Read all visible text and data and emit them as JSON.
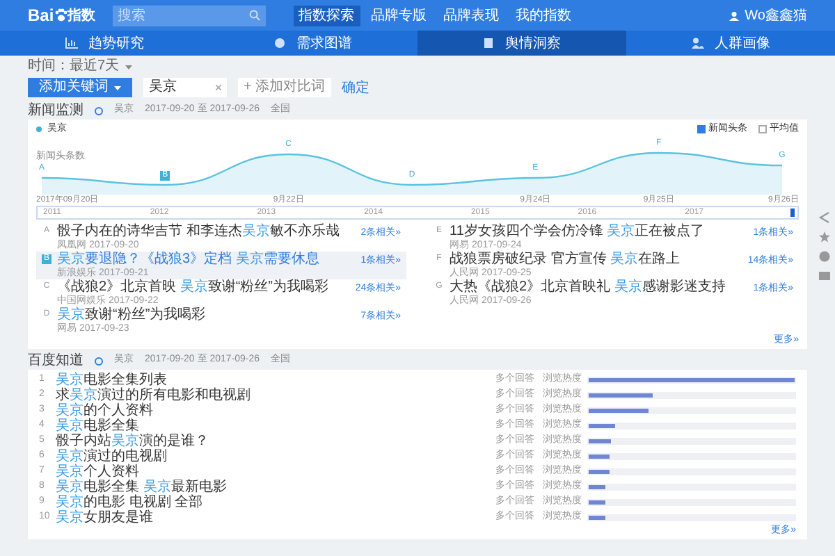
{
  "logo": {
    "text": "Bai",
    "suffix": "指数"
  },
  "search": {
    "placeholder": "搜索"
  },
  "nav": [
    {
      "label": "指数探索",
      "selected": true
    },
    {
      "label": "品牌专版",
      "selected": false
    },
    {
      "label": "品牌表现",
      "selected": false
    },
    {
      "label": "我的指数",
      "selected": false
    }
  ],
  "user": "Wo鑫鑫猫",
  "subnav": [
    {
      "label": "趋势研究",
      "selected": false
    },
    {
      "label": "需求图谱",
      "selected": false
    },
    {
      "label": "舆情洞察",
      "selected": true
    },
    {
      "label": "人群画像",
      "selected": false
    }
  ],
  "time_filter": "时间：最近7天",
  "keyword_bar": {
    "button": "添加关键词",
    "keyword": "吴京",
    "add": "+ 添加对比词",
    "confirm": "确定"
  },
  "news": {
    "title": "新闻监测",
    "meta": [
      "吴京",
      "2017-09-20 至 2017-09-26",
      "全国"
    ],
    "legend": "吴京",
    "y_label": "新闻头条数",
    "checkboxes": [
      {
        "label": "新闻头条",
        "checked": true
      },
      {
        "label": "平均值",
        "checked": false
      }
    ],
    "markers": [
      {
        "letter": "A",
        "selected": false
      },
      {
        "letter": "B",
        "selected": true
      },
      {
        "letter": "C",
        "selected": false
      },
      {
        "letter": "D",
        "selected": false
      },
      {
        "letter": "E",
        "selected": false
      },
      {
        "letter": "F",
        "selected": false
      },
      {
        "letter": "G",
        "selected": false
      }
    ],
    "x_labels": [
      "2017年09月20日",
      "9月22日",
      "9月24日",
      "9月25日",
      "9月26日"
    ],
    "timeline": {
      "years": [
        "2011",
        "2012",
        "2013",
        "2014",
        "2015",
        "2016",
        "2017"
      ],
      "level": 1
    },
    "items": [
      {
        "letter": "A",
        "selected": false,
        "parts": [
          {
            "text": "骰子内在的诗华吉节 和李连杰",
            "hl": false
          },
          {
            "text": "吴京",
            "hl": true
          },
          {
            "text": "敏不亦乐哉",
            "hl": false
          }
        ],
        "source": "凤凰网 2017-09-20",
        "related": "2条相关»"
      },
      {
        "letter": "B",
        "selected": true,
        "parts": [
          {
            "text": "吴京",
            "hl": true
          },
          {
            "text": "要退隐？《战狼3》定档 ",
            "hl": false
          },
          {
            "text": "吴京",
            "hl": true
          },
          {
            "text": "需要休息",
            "hl": false
          }
        ],
        "source": "新浪娱乐 2017-09-21",
        "related": "1条相关»"
      },
      {
        "letter": "C",
        "selected": false,
        "parts": [
          {
            "text": "《战狼2》北京首映 ",
            "hl": false
          },
          {
            "text": "吴京",
            "hl": true
          },
          {
            "text": "致谢“粉丝”为我喝彩",
            "hl": false
          }
        ],
        "source": "中国网娱乐 2017-09-22",
        "related": "24条相关»"
      },
      {
        "letter": "D",
        "selected": false,
        "parts": [
          {
            "text": "吴京",
            "hl": true
          },
          {
            "text": "致谢“粉丝”为我喝彩",
            "hl": false
          }
        ],
        "source": "网易 2017-09-23",
        "related": "7条相关»"
      },
      {
        "letter": "E",
        "selected": false,
        "parts": [
          {
            "text": "11岁女孩四个学会仿冷锋 ",
            "hl": false
          },
          {
            "text": "吴京",
            "hl": true
          },
          {
            "text": "正在被点了",
            "hl": false
          }
        ],
        "source": "网易 2017-09-24",
        "related": "1条相关»"
      },
      {
        "letter": "F",
        "selected": false,
        "parts": [
          {
            "text": "战狼票房破纪录 官方宣传 ",
            "hl": false
          },
          {
            "text": "吴京",
            "hl": true
          },
          {
            "text": "在路上",
            "hl": false
          }
        ],
        "source": "人民网 2017-09-25",
        "related": "14条相关»"
      },
      {
        "letter": "G",
        "selected": false,
        "parts": [
          {
            "text": "大热《战狼2》北京首映礼 ",
            "hl": false
          },
          {
            "text": "吴京",
            "hl": true
          },
          {
            "text": "感谢影迷支持",
            "hl": false
          }
        ],
        "source": "人民网 2017-09-26",
        "related": "1条相关»"
      }
    ],
    "more": "更多»"
  },
  "zhidao": {
    "title": "百度知道",
    "meta": [
      "吴京",
      "2017-09-20 至 2017-09-26",
      "全国"
    ],
    "items": [
      {
        "rank": "1",
        "parts": [
          {
            "text": "吴京",
            "hl": true
          },
          {
            "text": "电影全集列表",
            "hl": false
          }
        ],
        "answers": "多个回答",
        "heat_label": "浏览热度",
        "level": 1
      },
      {
        "rank": "2",
        "parts": [
          {
            "text": "求",
            "hl": false
          },
          {
            "text": "吴京",
            "hl": true
          },
          {
            "text": "演过的所有电影和电视剧",
            "hl": false
          }
        ],
        "answers": "多个回答",
        "heat_label": "浏览热度",
        "level": 0.31
      },
      {
        "rank": "3",
        "parts": [
          {
            "text": "吴京",
            "hl": true
          },
          {
            "text": "的个人资料",
            "hl": false
          }
        ],
        "answers": "多个回答",
        "heat_label": "浏览热度",
        "level": 0.29
      },
      {
        "rank": "4",
        "parts": [
          {
            "text": "吴京",
            "hl": true
          },
          {
            "text": "电影全集",
            "hl": false
          }
        ],
        "answers": "多个回答",
        "heat_label": "浏览热度",
        "level": 0.13
      },
      {
        "rank": "5",
        "parts": [
          {
            "text": "骰子内站",
            "hl": false
          },
          {
            "text": "吴京",
            "hl": true
          },
          {
            "text": "演的是谁？",
            "hl": false
          }
        ],
        "answers": "多个回答",
        "heat_label": "浏览热度",
        "level": 0.11
      },
      {
        "rank": "6",
        "parts": [
          {
            "text": "吴京",
            "hl": true
          },
          {
            "text": "演过的电视剧",
            "hl": false
          }
        ],
        "answers": "多个回答",
        "heat_label": "浏览热度",
        "level": 0.1
      },
      {
        "rank": "7",
        "parts": [
          {
            "text": "吴京",
            "hl": true
          },
          {
            "text": "个人资料",
            "hl": false
          }
        ],
        "answers": "多个回答",
        "heat_label": "浏览热度",
        "level": 0.1
      },
      {
        "rank": "8",
        "parts": [
          {
            "text": "吴京",
            "hl": true
          },
          {
            "text": "电影全集 ",
            "hl": false
          },
          {
            "text": "吴京",
            "hl": true
          },
          {
            "text": "最新电影",
            "hl": false
          }
        ],
        "answers": "多个回答",
        "heat_label": "浏览热度",
        "level": 0.08
      },
      {
        "rank": "9",
        "parts": [
          {
            "text": "吴京",
            "hl": true
          },
          {
            "text": "的电影 电视剧 全部",
            "hl": false
          }
        ],
        "answers": "多个回答",
        "heat_label": "浏览热度",
        "level": 0.08
      },
      {
        "rank": "10",
        "parts": [
          {
            "text": "吴京",
            "hl": true
          },
          {
            "text": "女朋友是谁",
            "hl": false
          }
        ],
        "answers": "多个回答",
        "heat_label": "浏览热度",
        "level": 0.08
      }
    ],
    "more": "更多»"
  }
}
